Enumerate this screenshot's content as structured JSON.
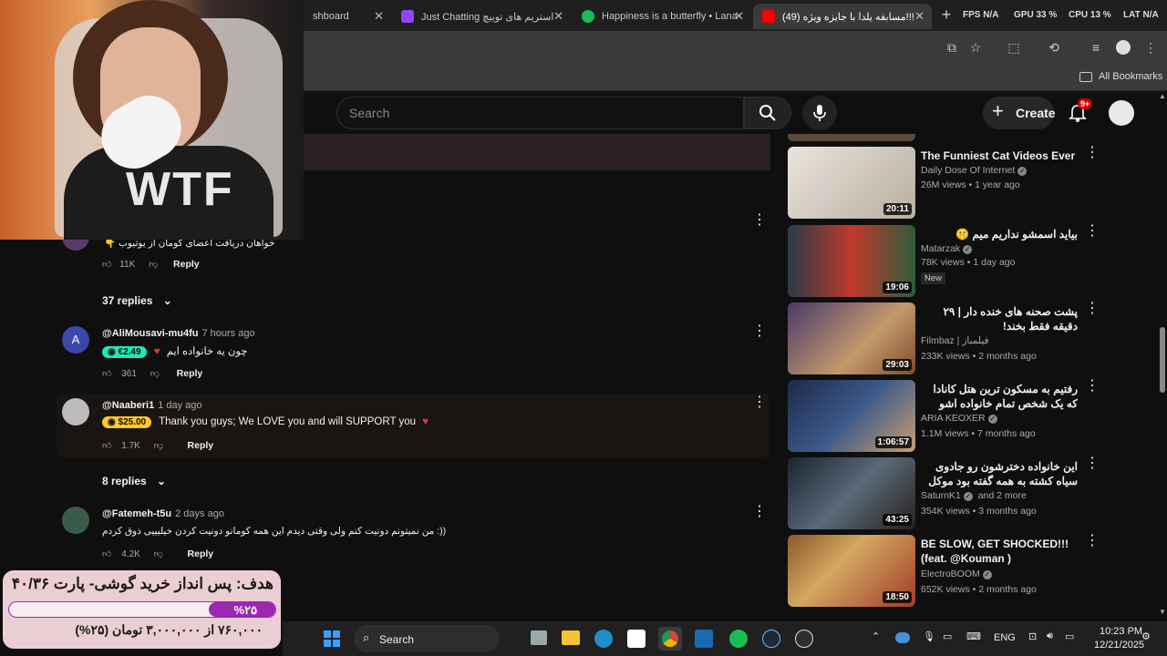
{
  "browser": {
    "tabs": [
      {
        "label": "shboard"
      },
      {
        "label": "Just Chatting استریم های توییچ"
      },
      {
        "label": "Happiness is a butterfly • Lana"
      },
      {
        "label": "(49) مسابقه یلدا با جایزه ویژه!!!"
      }
    ],
    "stats": {
      "fps_label": "FPS",
      "fps_val": "N/A",
      "gpu_label": "GPU",
      "gpu_val": "33 %",
      "cpu_label": "CPU",
      "cpu_val": "13 %",
      "lat_label": "LAT",
      "lat_val": "N/A"
    },
    "bookmarks_label": "All Bookmarks"
  },
  "youtube": {
    "search_placeholder": "Search",
    "create_label": "Create",
    "notif_count": "9+"
  },
  "comments": [
    {
      "text": "خواهان دریافت اعضای کومان از یوتیوب",
      "likes": "11K",
      "reply": "Reply"
    },
    {
      "replies_label": "37 replies"
    },
    {
      "user": "@AliMousavi-mu4fu",
      "time": "7 hours ago",
      "chip": "€2.49",
      "text": "چون یه خانواده ایم",
      "likes": "361",
      "reply": "Reply",
      "avatar_letter": "A"
    },
    {
      "user": "@Naaberi1",
      "time": "1 day ago",
      "chip": "$25.00",
      "text": "Thank you guys; We LOVE you and will SUPPORT you",
      "likes": "1.7K",
      "reply": "Reply"
    },
    {
      "replies_label": "8 replies"
    },
    {
      "user": "@Fatemeh-t5u",
      "time": "2 days ago",
      "text": "من نمیتونم دونیت کنم ولی وقتی دیدم این همه کومانو دونیت کردن خیلیییی ذوق کردم :))",
      "likes": "4.2K",
      "reply": "Reply"
    }
  ],
  "sidebar": [
    {
      "title": "The Funniest Cat Videos Ever",
      "channel": "Daily Dose Of Internet",
      "meta": "26M views • 1 year ago",
      "duration": "20:11"
    },
    {
      "title": "بیاید اسمشو نداریم میم 🤫",
      "channel": "Matarzak",
      "meta": "78K views • 1 day ago",
      "badge": "New",
      "duration": "19:06"
    },
    {
      "title": "پشت صحنه های خنده دار | ۲۹ دقیقه فقط بخند!",
      "channel": "Filmbaz | فیلمباز",
      "meta": "233K views • 2 months ago",
      "duration": "29:03"
    },
    {
      "title": "رفتیم به مسکون ترین هتل کانادا که یک شخص تمام خانواده اشو اونجا کشته ! (ft. ...",
      "channel": "ARIA KEOXER",
      "meta": "1.1M views • 7 months ago",
      "duration": "1:06:57"
    },
    {
      "title": "این خانواده دخترشون رو جادوی سیاه کشته به همه گفته بود موکل جن داره و فراره...",
      "channel": "SaturnK1",
      "channel_extra": "and 2 more",
      "meta": "354K views • 3 months ago",
      "duration": "43:25"
    },
    {
      "title": "BE SLOW, GET SHOCKED!!! (feat. @Kouman )",
      "channel": "ElectroBOOM",
      "meta": "652K views • 2 months ago",
      "duration": "18:50"
    }
  ],
  "overlay": {
    "goal_title": "هدف: پس انداز خرید گوشی- پارت ۴۰/۳۶",
    "goal_percent_label": "%۲۵",
    "goal_fraction": 0.25,
    "goal_amount": "۷۶۰,۰۰۰ از ۳,۰۰۰,۰۰۰ تومان (۲۵%)",
    "cam_shirt": "WTF"
  },
  "taskbar": {
    "search_label": "Search",
    "lang": "ENG",
    "time": "10:23 PM",
    "date": "12/21/2025"
  },
  "colors": {
    "accent_red": "#ff0000",
    "chip_cyan": "#1de9b6",
    "chip_orange": "#ffca28",
    "goal_bar": "#9c27b0"
  }
}
